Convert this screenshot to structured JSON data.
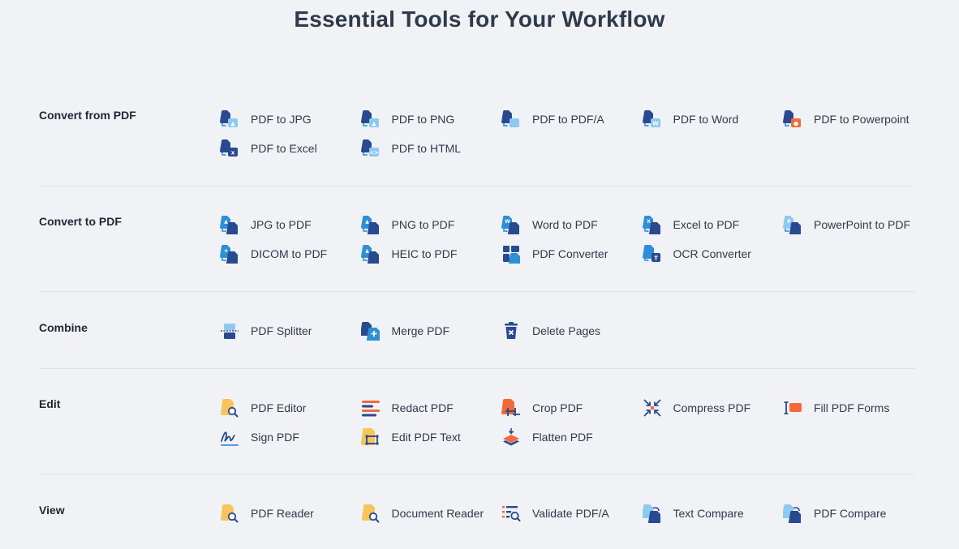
{
  "page": {
    "title": "Essential Tools for Your Workflow"
  },
  "colors": {
    "navy": "#284a8f",
    "blue": "#2f8fd6",
    "light": "#8ec9ef",
    "orange": "#f26a3b",
    "yellow": "#f7c55a"
  },
  "sections": [
    {
      "label": "Convert from PDF",
      "tools": [
        {
          "label": "PDF to JPG",
          "icon": "pdf-to-jpg-icon"
        },
        {
          "label": "PDF to PNG",
          "icon": "pdf-to-png-icon"
        },
        {
          "label": "PDF to PDF/A",
          "icon": "pdf-to-pdfa-icon"
        },
        {
          "label": "PDF to Word",
          "icon": "pdf-to-word-icon"
        },
        {
          "label": "PDF to Powerpoint",
          "icon": "pdf-to-powerpoint-icon"
        },
        {
          "label": "PDF to Excel",
          "icon": "pdf-to-excel-icon"
        },
        {
          "label": "PDF to HTML",
          "icon": "pdf-to-html-icon"
        }
      ]
    },
    {
      "label": "Convert to PDF",
      "tools": [
        {
          "label": "JPG to PDF",
          "icon": "jpg-to-pdf-icon"
        },
        {
          "label": "PNG to PDF",
          "icon": "png-to-pdf-icon"
        },
        {
          "label": "Word to PDF",
          "icon": "word-to-pdf-icon"
        },
        {
          "label": "Excel to PDF",
          "icon": "excel-to-pdf-icon"
        },
        {
          "label": "PowerPoint to PDF",
          "icon": "powerpoint-to-pdf-icon"
        },
        {
          "label": "DICOM to PDF",
          "icon": "dicom-to-pdf-icon"
        },
        {
          "label": "HEIC to PDF",
          "icon": "heic-to-pdf-icon"
        },
        {
          "label": "PDF Converter",
          "icon": "pdf-converter-icon"
        },
        {
          "label": "OCR Converter",
          "icon": "ocr-converter-icon"
        }
      ]
    },
    {
      "label": "Combine",
      "tools": [
        {
          "label": "PDF Splitter",
          "icon": "pdf-splitter-icon"
        },
        {
          "label": "Merge PDF",
          "icon": "merge-pdf-icon"
        },
        {
          "label": "Delete Pages",
          "icon": "delete-pages-icon"
        }
      ]
    },
    {
      "label": "Edit",
      "tools": [
        {
          "label": "PDF Editor",
          "icon": "pdf-editor-icon"
        },
        {
          "label": "Redact PDF",
          "icon": "redact-pdf-icon"
        },
        {
          "label": "Crop PDF",
          "icon": "crop-pdf-icon"
        },
        {
          "label": "Compress PDF",
          "icon": "compress-pdf-icon"
        },
        {
          "label": "Fill PDF Forms",
          "icon": "fill-pdf-forms-icon"
        },
        {
          "label": "Sign PDF",
          "icon": "sign-pdf-icon"
        },
        {
          "label": "Edit PDF Text",
          "icon": "edit-pdf-text-icon"
        },
        {
          "label": "Flatten PDF",
          "icon": "flatten-pdf-icon"
        }
      ]
    },
    {
      "label": "View",
      "tools": [
        {
          "label": "PDF Reader",
          "icon": "pdf-reader-icon"
        },
        {
          "label": "Document Reader",
          "icon": "document-reader-icon"
        },
        {
          "label": "Validate PDF/A",
          "icon": "validate-pdfa-icon"
        },
        {
          "label": "Text Compare",
          "icon": "text-compare-icon"
        },
        {
          "label": "PDF Compare",
          "icon": "pdf-compare-icon"
        }
      ]
    }
  ]
}
